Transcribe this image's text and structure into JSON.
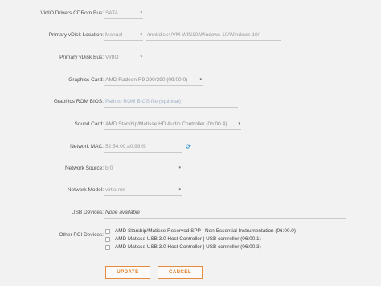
{
  "form": {
    "cdrom_bus": {
      "label": "VirtIO Drivers CDRom Bus:",
      "value": "SATA"
    },
    "vdisk_location": {
      "label": "Primary vDisk Location:",
      "mode": "Manual",
      "path": "/mnt/disk4/VM-WIN10/Windows 10/Windows 10/"
    },
    "vdisk_bus": {
      "label": "Primary vDisk Bus:",
      "value": "VirtIO"
    },
    "graphics_card": {
      "label": "Graphics Card:",
      "value": "AMD Radeon R9 290/390 (09:00.0)"
    },
    "graphics_rom": {
      "label": "Graphics ROM BIOS:",
      "placeholder": "Path to ROM BIOS file (optional)"
    },
    "sound_card": {
      "label": "Sound Card:",
      "value": "AMD Starship/Matisse HD Audio Controller (0b:00.4)"
    },
    "network_mac": {
      "label": "Network MAC:",
      "value": "52:54:00:a0:99:f9"
    },
    "network_source": {
      "label": "Network Source:",
      "value": "br0"
    },
    "network_model": {
      "label": "Network Model:",
      "value": "virtio-net"
    },
    "usb_devices": {
      "label": "USB Devices:",
      "value": "None available"
    },
    "other_pci": {
      "label": "Other PCI Devices:",
      "items": [
        {
          "text": "AMD Starship/Matisse Reserved SPP | Non-Essential Instrumentation (06:00.0)",
          "checked": false
        },
        {
          "text": "AMD Matisse USB 3.0 Host Controller | USB controller (06:00.1)",
          "checked": false
        },
        {
          "text": "AMD Matisse USB 3.0 Host Controller | USB controller (06:00.3)",
          "checked": false
        }
      ]
    }
  },
  "icons": {
    "caret": "▾",
    "refresh": "⟳"
  },
  "buttons": {
    "update": "UPDATE",
    "cancel": "CANCEL"
  },
  "colors": {
    "accent": "#e07b1f",
    "refresh": "#2a8fd1"
  }
}
